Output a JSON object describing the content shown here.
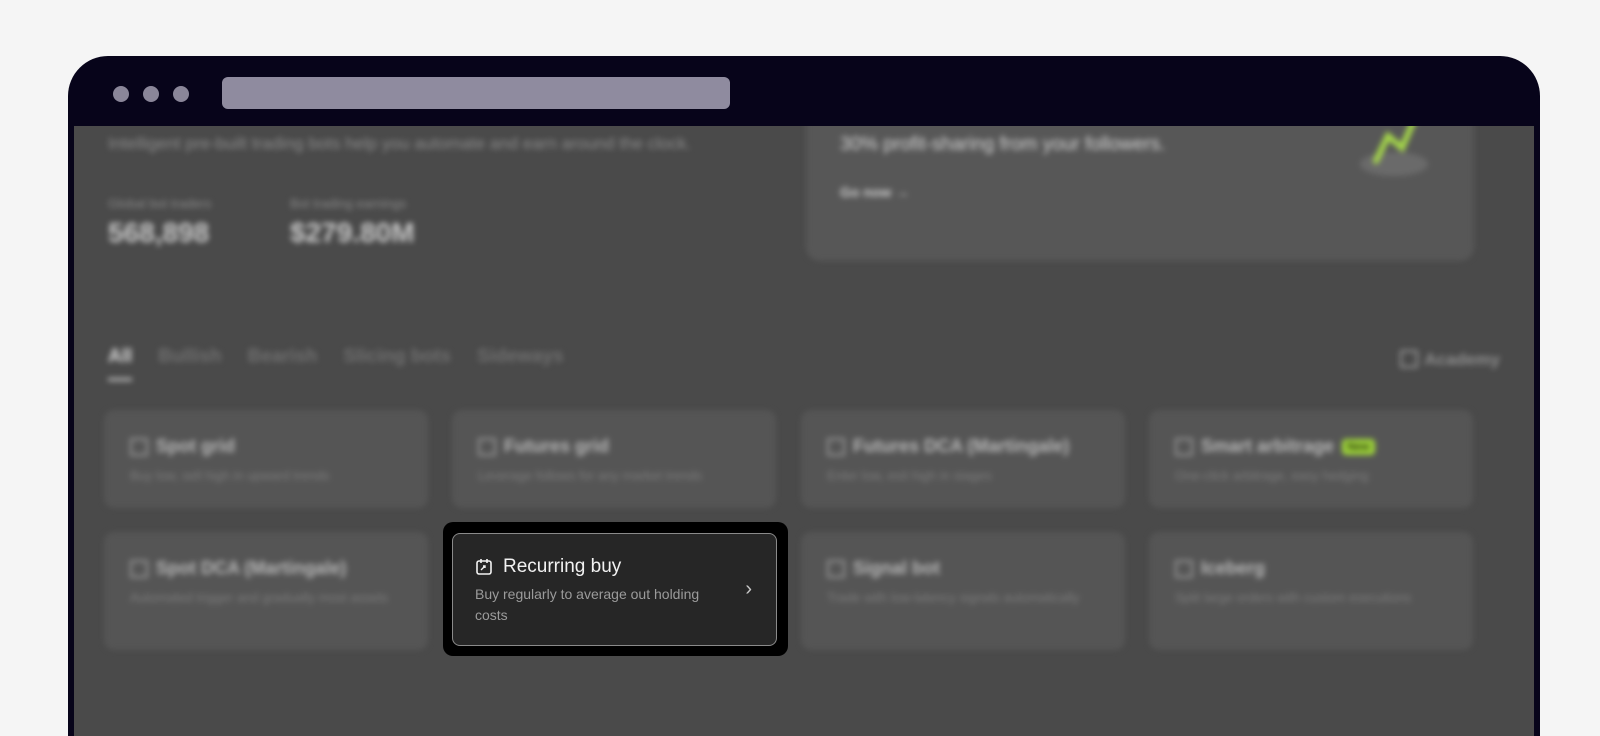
{
  "hero": {
    "subtitle": "Intelligent pre-built trading bots help you automate and earn around the clock.",
    "stats": [
      {
        "label": "Global bot traders",
        "value": "568,898"
      },
      {
        "label": "Bot trading earnings",
        "value": "$279.80M"
      }
    ]
  },
  "promo": {
    "text": "30% profit-sharing from your followers.",
    "link": "Go now →"
  },
  "tabs": [
    "All",
    "Bullish",
    "Bearish",
    "Slicing bots",
    "Sideways"
  ],
  "academy_label": "Academy",
  "cards_row1": [
    {
      "title": "Spot grid",
      "desc": "Buy low, sell high in upward trends"
    },
    {
      "title": "Futures grid",
      "desc": "Leverage follows for any market trends"
    },
    {
      "title": "Futures DCA (Martingale)",
      "desc": "Enter low, exit high in stages"
    },
    {
      "title": "Smart arbitrage",
      "badge": "New",
      "desc": "One-click arbitrage, easy hedging"
    }
  ],
  "cards_row2": [
    {
      "title": "Spot DCA (Martingale)",
      "desc": "Automated trigger and gradually most assets"
    },
    {
      "title": "Signal bot",
      "desc": "Trade with low-latency signals automatically"
    },
    {
      "title": "Iceberg",
      "desc": "Split large orders with custom executions"
    }
  ],
  "focus_card": {
    "title": "Recurring buy",
    "desc": "Buy regularly to average out holding costs"
  }
}
